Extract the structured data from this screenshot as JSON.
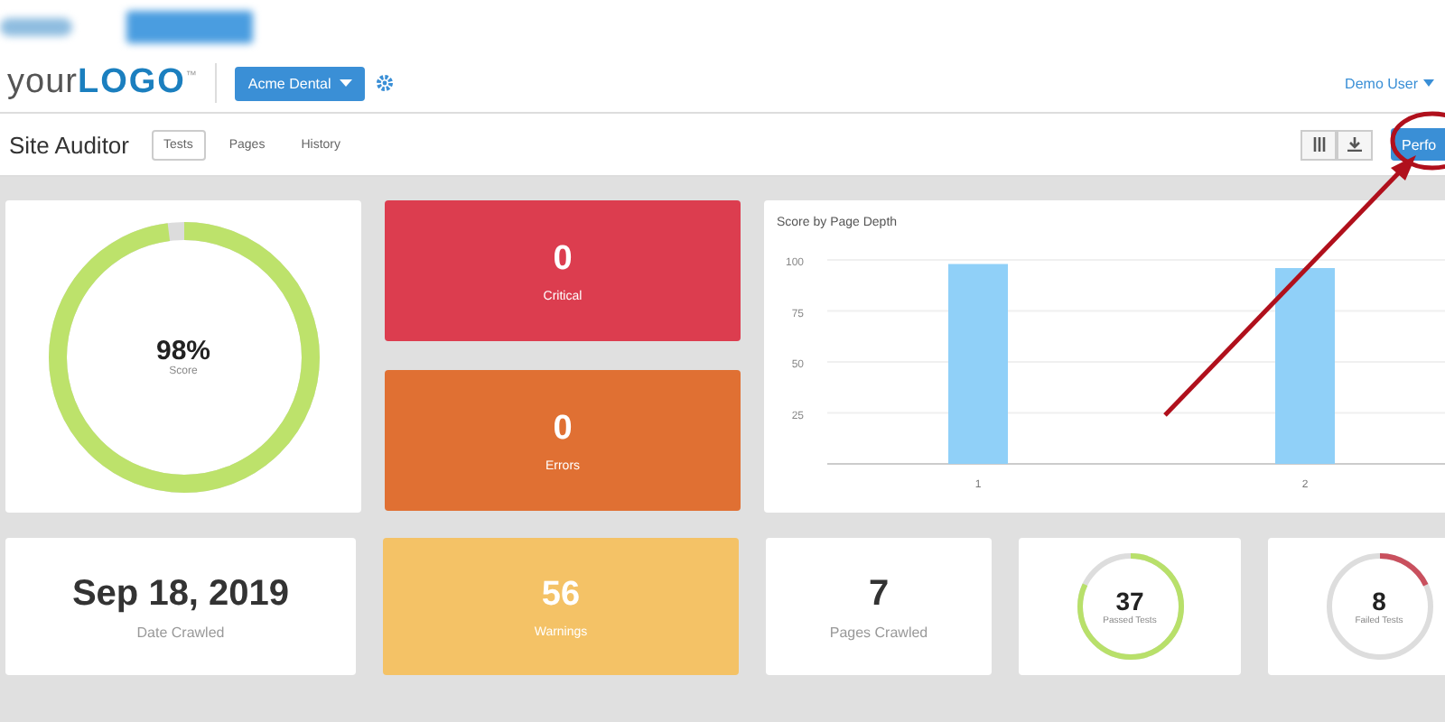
{
  "header": {
    "logo_plain": "your",
    "logo_bold": "LOGO",
    "logo_mark": "™",
    "account_button": "Acme Dental",
    "user_menu": "Demo User"
  },
  "toolbar": {
    "title": "Site Auditor",
    "tabs": [
      {
        "label": "Tests",
        "selected": true
      },
      {
        "label": "Pages",
        "selected": false
      },
      {
        "label": "History",
        "selected": false
      }
    ],
    "action_button": "Perfo"
  },
  "score": {
    "value": "98%",
    "label": "Score",
    "level": 0.98
  },
  "counts": [
    {
      "kind": "critical",
      "value": "0",
      "label": "Critical",
      "color": "#dc3d4f"
    },
    {
      "kind": "errors",
      "value": "0",
      "label": "Errors",
      "color": "#e07033"
    },
    {
      "kind": "warnings",
      "value": "56",
      "label": "Warnings",
      "color": "#f4c266"
    }
  ],
  "chart": {
    "chart_data": {
      "type": "bar",
      "title": "Score by Page Depth",
      "categories": [
        "1",
        "2"
      ],
      "values": [
        98,
        96
      ],
      "ylim": [
        0,
        100
      ],
      "yticks": [
        25,
        50,
        75,
        100
      ],
      "grid": true
    }
  },
  "date": {
    "value": "Sep 18, 2019",
    "label": "Date Crawled"
  },
  "pages": {
    "value": "7",
    "label": "Pages Crawled"
  },
  "tests": [
    {
      "value": "37",
      "label": "Passed Tests",
      "level": 0.82,
      "color": "#b8e06a"
    },
    {
      "value": "8",
      "label": "Failed Tests",
      "level": 0.18,
      "color": "#c9505e"
    }
  ]
}
